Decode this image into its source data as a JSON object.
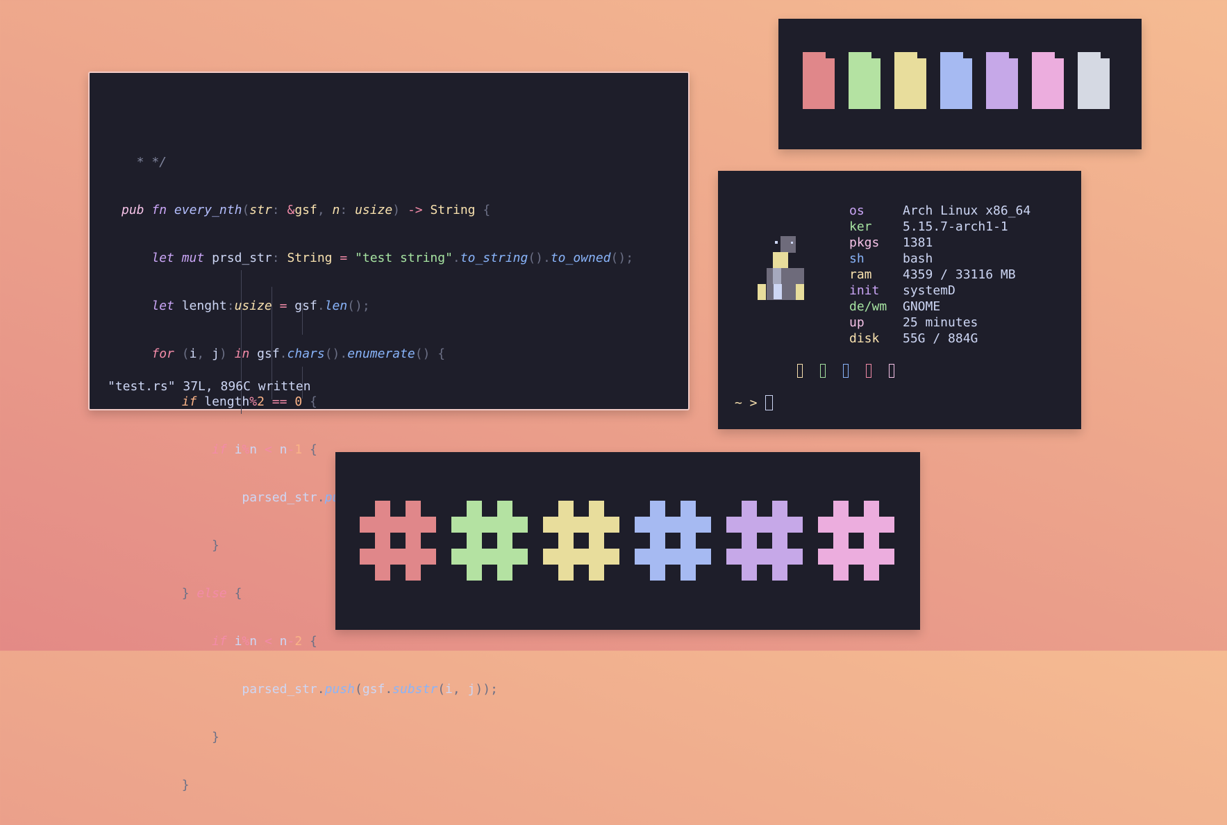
{
  "code_window": {
    "status_line": "\"test.rs\" 37L, 896C written"
  },
  "fetch": {
    "rows": [
      {
        "key": "os",
        "value": "Arch Linux x86_64",
        "color": "#cba6f7"
      },
      {
        "key": "ker",
        "value": "5.15.7-arch1-1",
        "color": "#a6e3a1"
      },
      {
        "key": "pkgs",
        "value": "1381",
        "color": "#f5c2e7"
      },
      {
        "key": "sh",
        "value": "bash",
        "color": "#89b4fa"
      },
      {
        "key": "ram",
        "value": "4359 / 33116 MB",
        "color": "#f9e2af"
      },
      {
        "key": "init",
        "value": "systemD",
        "color": "#cba6f7"
      },
      {
        "key": "de/wm",
        "value": "GNOME",
        "color": "#a6e3a1"
      },
      {
        "key": "up",
        "value": "25 minutes",
        "color": "#f5c2e7"
      },
      {
        "key": "disk",
        "value": "55G / 884G",
        "color": "#f9e2af"
      }
    ],
    "prompt": "~ >"
  },
  "palette": {
    "colors": [
      "#e0878a",
      "#b4e2a2",
      "#e8dd9c",
      "#a6baf2",
      "#c6a8e8",
      "#ecadde",
      "#d5d9e3"
    ]
  }
}
